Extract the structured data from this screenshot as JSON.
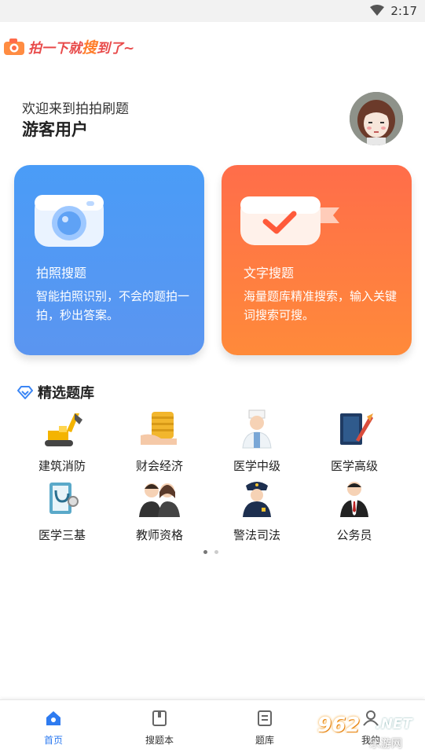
{
  "status_bar": {
    "time": "2:17"
  },
  "brand": {
    "slogan_part1": "拍一下就",
    "slogan_highlight": "搜",
    "slogan_part2": "到了~"
  },
  "header": {
    "welcome": "欢迎来到拍拍刷题",
    "username": "游客用户"
  },
  "cards": [
    {
      "title": "拍照搜题",
      "description": "智能拍照识别，不会的题拍一拍，秒出答案。",
      "color": "#4a9cf7"
    },
    {
      "title": "文字搜题",
      "description": "海量题库精准搜索，输入关键词搜索可搜。",
      "color": "#ff7a3f"
    }
  ],
  "section": {
    "title": "精选题库"
  },
  "categories": [
    {
      "label": "建筑消防",
      "icon": "excavator-icon"
    },
    {
      "label": "财会经济",
      "icon": "coins-icon"
    },
    {
      "label": "医学中级",
      "icon": "doctor-icon"
    },
    {
      "label": "医学高级",
      "icon": "book-quill-icon"
    },
    {
      "label": "医学三基",
      "icon": "stethoscope-icon"
    },
    {
      "label": "教师资格",
      "icon": "teachers-icon"
    },
    {
      "label": "警法司法",
      "icon": "police-icon"
    },
    {
      "label": "公务员",
      "icon": "civil-servant-icon"
    }
  ],
  "pager": {
    "pages": 2,
    "current": 1
  },
  "tabbar": {
    "items": [
      {
        "label": "首页",
        "icon": "home-icon",
        "active": true
      },
      {
        "label": "搜题本",
        "icon": "notebook-icon",
        "active": false
      },
      {
        "label": "题库",
        "icon": "list-icon",
        "active": false
      },
      {
        "label": "我的",
        "icon": "user-icon",
        "active": false
      }
    ]
  },
  "watermark": {
    "number": "962",
    "suffix": ".NET",
    "sub": "乐游网"
  },
  "colors": {
    "accent": "#2e7bf0",
    "card_blue": "#4a9cf7",
    "card_orange": "#ff7a3f"
  }
}
